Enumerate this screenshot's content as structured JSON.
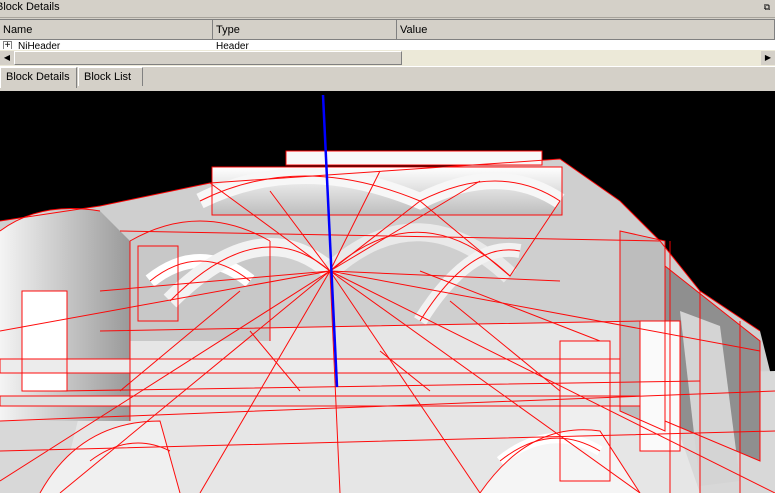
{
  "panel": {
    "title": "Block Details",
    "restore_icon": "restore-window-icon",
    "columns": [
      "Name",
      "Type",
      "Value"
    ],
    "rows": [
      {
        "name": "NiHeader",
        "type": "Header",
        "value": ""
      }
    ]
  },
  "tabs": [
    {
      "label": "Block Details",
      "active": true
    },
    {
      "label": "Block List",
      "active": false
    }
  ],
  "viewport": {
    "background": "#000000",
    "wire_color": "#ff0000",
    "axis_color": "#0000ff"
  }
}
